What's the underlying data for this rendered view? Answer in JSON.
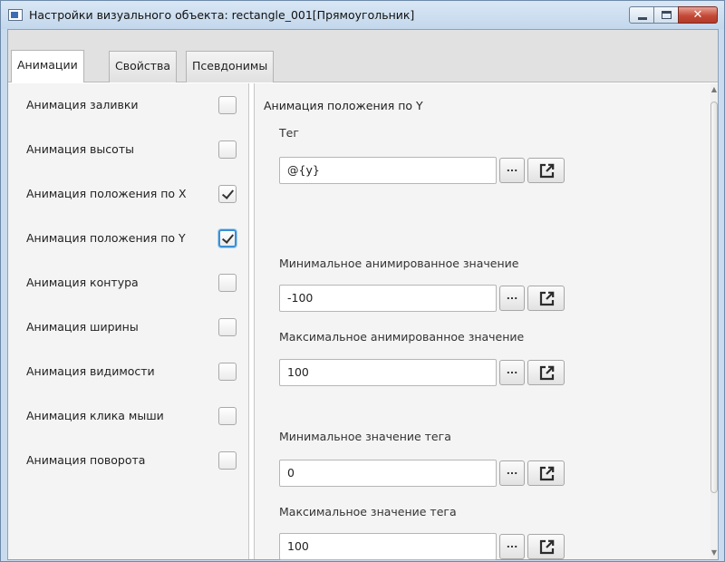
{
  "window": {
    "title": "Настройки визуального объекта: rectangle_001[Прямоугольник]",
    "buttons": {
      "minimize": "minimize",
      "maximize": "maximize",
      "close": "✕"
    }
  },
  "tabs": [
    {
      "label": "Анимации",
      "active": true
    },
    {
      "label": "Свойства",
      "active": false
    },
    {
      "label": "Псевдонимы",
      "active": false
    }
  ],
  "animations": [
    {
      "label": "Анимация заливки",
      "checked": false
    },
    {
      "label": "Анимация высоты",
      "checked": false
    },
    {
      "label": "Анимация положения по X",
      "checked": true
    },
    {
      "label": "Анимация положения по Y",
      "checked": true,
      "focused": true
    },
    {
      "label": "Анимация контура",
      "checked": false
    },
    {
      "label": "Анимация ширины",
      "checked": false
    },
    {
      "label": "Анимация видимости",
      "checked": false
    },
    {
      "label": "Анимация клика мыши",
      "checked": false
    },
    {
      "label": "Анимация поворота",
      "checked": false
    }
  ],
  "detail": {
    "section_title": "Анимация положения по Y",
    "fields": [
      {
        "label": "Тег",
        "value": "@{y}"
      },
      {
        "label": "Минимальное анимированное значение",
        "value": "-100"
      },
      {
        "label": "Максимальное анимированное значение",
        "value": "100"
      },
      {
        "label": "Минимальное значение тега",
        "value": "0"
      },
      {
        "label": "Максимальное значение тега",
        "value": "100"
      }
    ],
    "browse_button_label": "..."
  },
  "icons": {
    "app": "app-window-icon",
    "external": "open-external-icon",
    "scroll_up": "scroll-up-arrow-icon",
    "scroll_down": "scroll-down-arrow-icon"
  },
  "colors": {
    "titlebar": "#c3d7ec",
    "close_button": "#c44a37",
    "focus_ring": "#3a8fd6"
  }
}
